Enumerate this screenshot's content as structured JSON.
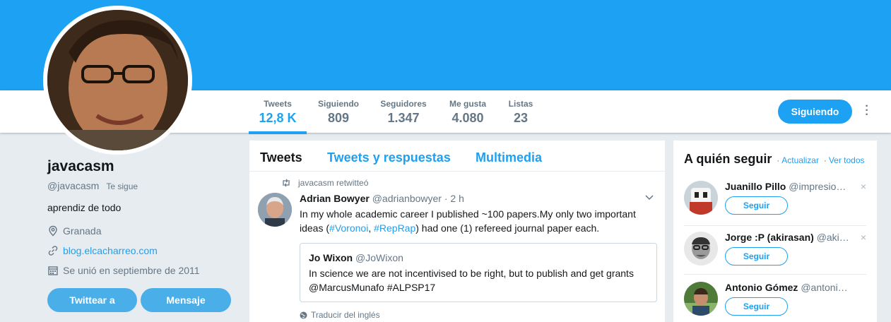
{
  "profile": {
    "name": "javacasm",
    "handle": "@javacasm",
    "follows_you": "Te sigue",
    "bio": "aprendiz de todo",
    "location": "Granada",
    "website": "blog.elcacharreo.com",
    "joined": "Se unió en septiembre de 2011",
    "tweet_button": "Twittear a",
    "message_button": "Mensaje"
  },
  "stats": [
    {
      "label": "Tweets",
      "value": "12,8 K"
    },
    {
      "label": "Siguiendo",
      "value": "809"
    },
    {
      "label": "Seguidores",
      "value": "1.347"
    },
    {
      "label": "Me gusta",
      "value": "4.080"
    },
    {
      "label": "Listas",
      "value": "23"
    }
  ],
  "header": {
    "following_button": "Siguiendo",
    "more_icon": "more-vertical-icon"
  },
  "timeline": {
    "tabs": [
      "Tweets",
      "Tweets y respuestas",
      "Multimedia"
    ],
    "tweet": {
      "retweet_label": "javacasm retwitteó",
      "author_name": "Adrian Bowyer",
      "author_handle": "@adrianbowyer",
      "time": "· 2 h",
      "text_1": "In my whole academic career I published ~100 papers.My only two important ideas (",
      "hashtag_1": "#Voronoi",
      "text_2": ", ",
      "hashtag_2": "#RepRap",
      "text_3": ") had one (1) refereed journal paper each.",
      "quote": {
        "author_name": "Jo Wixon",
        "author_handle": "@JoWixon",
        "text": "In science we are not incentivised to be right, but to publish and get grants @MarcusMunafo #ALPSP17"
      },
      "translate": "Traducir del inglés"
    }
  },
  "who_to_follow": {
    "title": "A quién seguir",
    "separator": "·",
    "refresh": "Actualizar",
    "view_all": "Ver todos",
    "follow_label": "Seguir",
    "users": [
      {
        "name": "Juanillo Pillo",
        "handle": "@impresio…"
      },
      {
        "name": "Jorge :P (akirasan)",
        "handle": "@aki…"
      },
      {
        "name": "Antonio Gómez",
        "handle": "@antoni…"
      }
    ]
  },
  "colors": {
    "accent": "#1da1f2",
    "banner": "#1da1f2",
    "background": "#e6ecf0"
  }
}
